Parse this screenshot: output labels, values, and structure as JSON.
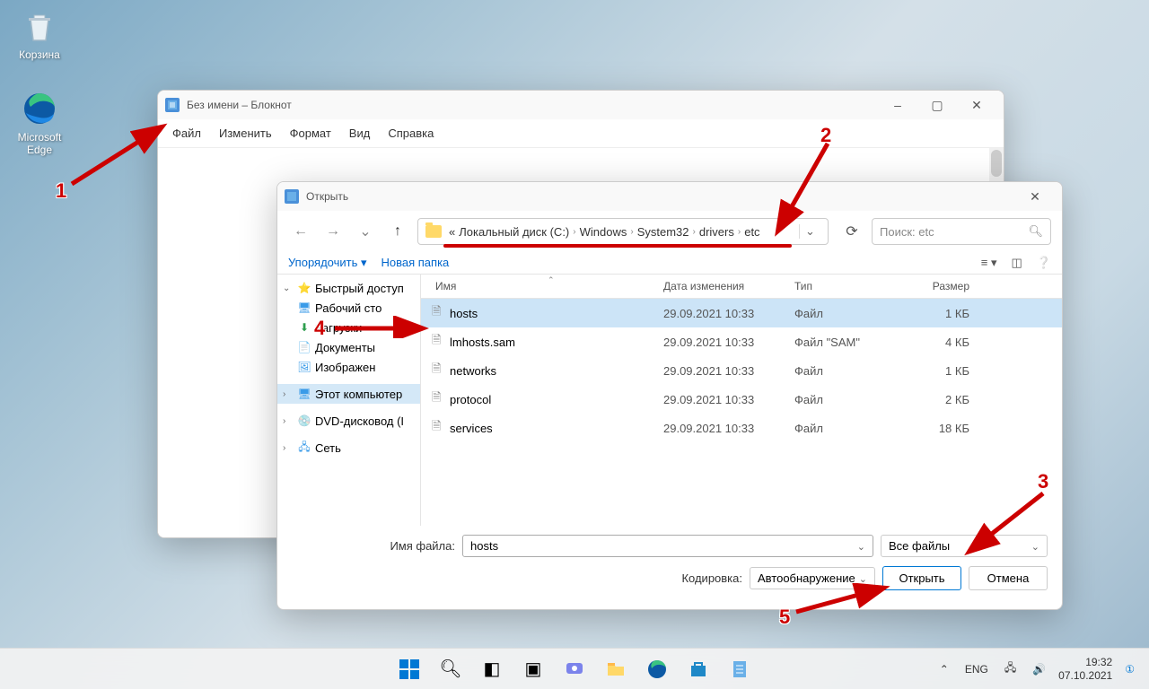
{
  "desktop": {
    "recycle_bin": "Корзина",
    "edge": "Microsoft Edge"
  },
  "notepad": {
    "title": "Без имени – Блокнот",
    "menu": {
      "file": "Файл",
      "edit": "Изменить",
      "format": "Формат",
      "view": "Вид",
      "help": "Справка"
    }
  },
  "dialog": {
    "title": "Открыть",
    "breadcrumb": {
      "prefix": "«",
      "parts": [
        "Локальный диск (C:)",
        "Windows",
        "System32",
        "drivers",
        "etc"
      ]
    },
    "search_placeholder": "Поиск: etc",
    "organize": "Упорядочить",
    "new_folder": "Новая папка",
    "sidebar": {
      "quick": "Быстрый доступ",
      "desktop": "Рабочий сто",
      "downloads": "Загрузки",
      "documents": "Документы",
      "images": "Изображен",
      "thispc": "Этот компьютер",
      "dvd": "DVD-дисковод (I",
      "network": "Сеть"
    },
    "columns": {
      "name": "Имя",
      "date": "Дата изменения",
      "type": "Тип",
      "size": "Размер"
    },
    "files": [
      {
        "name": "hosts",
        "date": "29.09.2021 10:33",
        "type": "Файл",
        "size": "1 КБ",
        "selected": true
      },
      {
        "name": "lmhosts.sam",
        "date": "29.09.2021 10:33",
        "type": "Файл \"SAM\"",
        "size": "4 КБ",
        "selected": false
      },
      {
        "name": "networks",
        "date": "29.09.2021 10:33",
        "type": "Файл",
        "size": "1 КБ",
        "selected": false
      },
      {
        "name": "protocol",
        "date": "29.09.2021 10:33",
        "type": "Файл",
        "size": "2 КБ",
        "selected": false
      },
      {
        "name": "services",
        "date": "29.09.2021 10:33",
        "type": "Файл",
        "size": "18 КБ",
        "selected": false
      }
    ],
    "filename_label": "Имя файла:",
    "filename_value": "hosts",
    "filetype_value": "Все файлы",
    "encoding_label": "Кодировка:",
    "encoding_value": "Автообнаружение",
    "open_btn": "Открыть",
    "cancel_btn": "Отмена"
  },
  "taskbar": {
    "lang": "ENG",
    "time": "19:32",
    "date": "07.10.2021"
  },
  "annotations": {
    "n1": "1",
    "n2": "2",
    "n3": "3",
    "n4": "4",
    "n5": "5"
  }
}
